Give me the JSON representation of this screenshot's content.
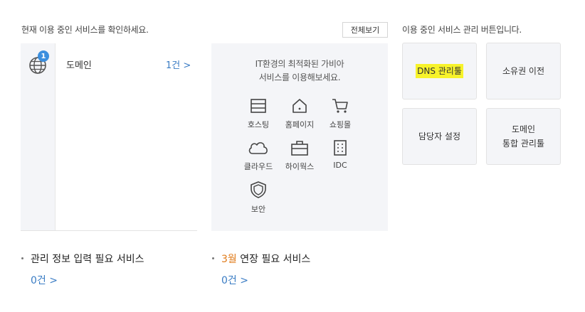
{
  "left": {
    "header": "현재 이용 중인 서비스를 확인하세요.",
    "view_all": "전체보기",
    "service": {
      "badge": "1",
      "name": "도메인",
      "count": "1건 >"
    }
  },
  "promo": {
    "line1": "IT환경의 최적화된 가비아",
    "line2": "서비스를 이용해보세요.",
    "items": [
      {
        "label": "호스팅",
        "icon": "server-icon"
      },
      {
        "label": "홈페이지",
        "icon": "home-icon"
      },
      {
        "label": "쇼핑몰",
        "icon": "cart-icon"
      },
      {
        "label": "클라우드",
        "icon": "cloud-icon"
      },
      {
        "label": "하이웍스",
        "icon": "toolbox-icon"
      },
      {
        "label": "IDC",
        "icon": "building-icon"
      },
      {
        "label": "보안",
        "icon": "shield-icon"
      }
    ]
  },
  "right": {
    "header": "이용 중인 서비스 관리 버튼입니다.",
    "buttons": [
      "DNS 관리툴",
      "소유권 이전",
      "담당자 설정",
      "도메인",
      "통합 관리툴"
    ]
  },
  "bottom": {
    "info": {
      "label": "관리 정보 입력 필요 서비스",
      "count": "0건 >"
    },
    "renew": {
      "month": "3월",
      "label": " 연장 필요 서비스",
      "count": "0건 >"
    }
  },
  "colors": {
    "accent": "#3c8fde",
    "link": "#3a7cc4",
    "highlight": "#f7f32b",
    "orange": "#e07b1a",
    "panel": "#f4f5f8"
  }
}
